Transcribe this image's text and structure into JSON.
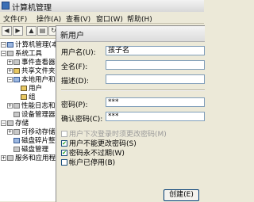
{
  "window": {
    "title": "计算机管理"
  },
  "menu": [
    "文件(F)",
    "操作(A)",
    "查看(V)",
    "窗口(W)",
    "帮助(H)"
  ],
  "tree": [
    {
      "label": "计算机管理(本地)",
      "expander": "−",
      "icon": "computer-icon"
    },
    {
      "label": "系统工具",
      "expander": "−",
      "icon": "tools-icon"
    },
    {
      "label": "事件查看器",
      "expander": "+",
      "icon": "event-viewer-icon"
    },
    {
      "label": "共享文件夹",
      "expander": "+",
      "icon": "shared-folder-icon"
    },
    {
      "label": "本地用户和组",
      "expander": "−",
      "icon": "users-icon"
    },
    {
      "label": "用户",
      "expander": "",
      "icon": "folder-icon"
    },
    {
      "label": "组",
      "expander": "",
      "icon": "folder-icon"
    },
    {
      "label": "性能日志和警报",
      "expander": "+",
      "icon": "performance-icon"
    },
    {
      "label": "设备管理器",
      "expander": "",
      "icon": "device-manager-icon"
    },
    {
      "label": "存储",
      "expander": "−",
      "icon": "storage-icon"
    },
    {
      "label": "可移动存储",
      "expander": "+",
      "icon": "removable-storage-icon"
    },
    {
      "label": "磁盘碎片整理",
      "expander": "",
      "icon": "defrag-icon"
    },
    {
      "label": "磁盘管理",
      "expander": "",
      "icon": "disk-icon"
    },
    {
      "label": "服务和应用程序",
      "expander": "+",
      "icon": "services-icon"
    }
  ],
  "dialog": {
    "title": "新用户",
    "username_label": "用户名(U):",
    "username_value": "孩子名",
    "fullname_label": "全名(F):",
    "fullname_value": "",
    "description_label": "描述(D):",
    "description_value": "",
    "password_label": "密码(P):",
    "password_value": "***",
    "confirm_label": "确认密码(C):",
    "confirm_value": "***",
    "checkboxes": [
      {
        "label": "用户下次登录时须更改密码(M)",
        "checked": false,
        "disabled": true
      },
      {
        "label": "用户不能更改密码(S)",
        "checked": true,
        "disabled": false
      },
      {
        "label": "密码永不过期(W)",
        "checked": true,
        "disabled": false
      },
      {
        "label": "帐户已停用(B)",
        "checked": false,
        "disabled": false
      }
    ],
    "create_button": "创建(E)"
  }
}
